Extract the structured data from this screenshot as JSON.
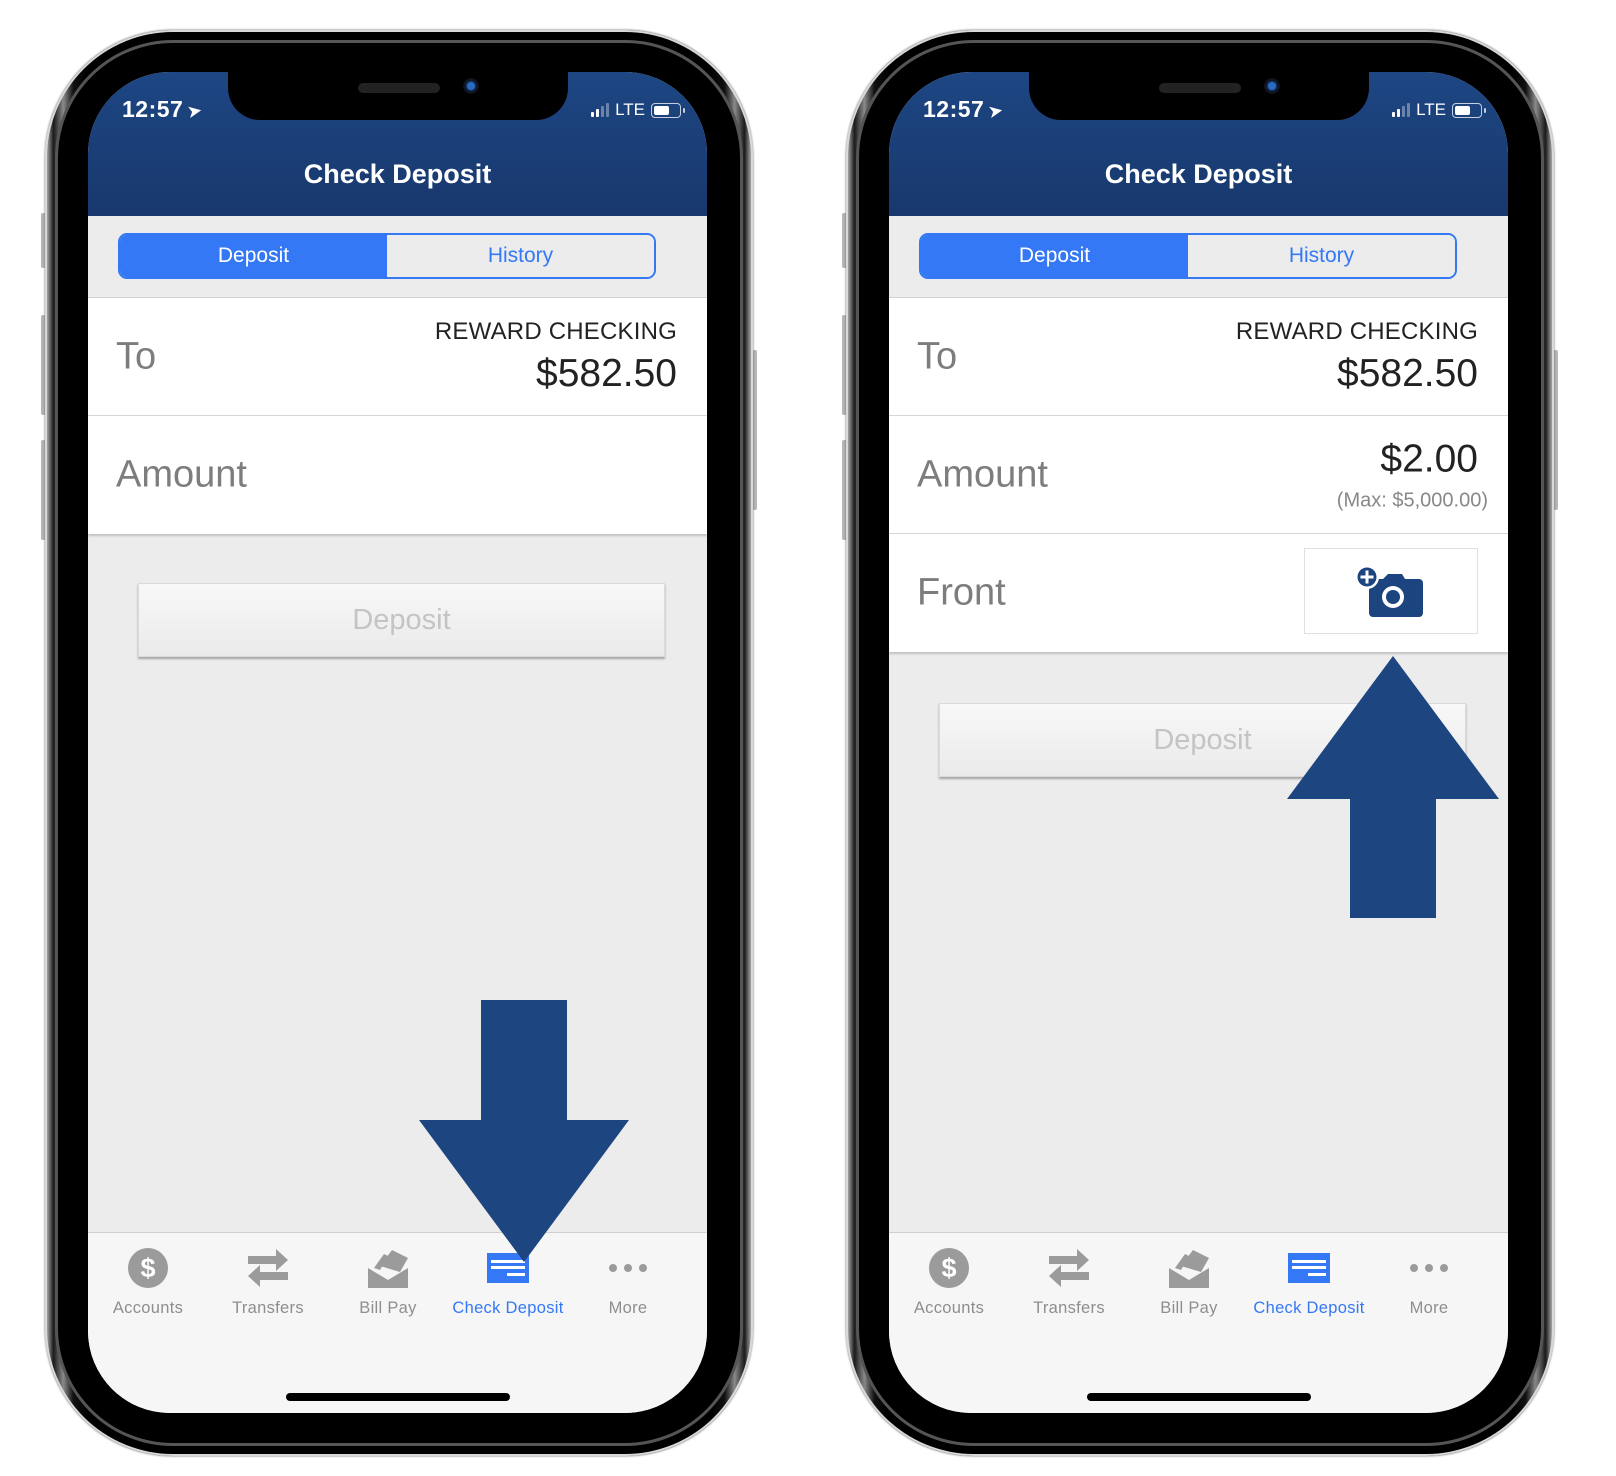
{
  "colors": {
    "header_blue": "#1d4683",
    "accent_blue": "#3478f6",
    "arrow_blue": "#1d4580",
    "camera_icon_blue": "#1c4580",
    "tab_inactive_gray": "#8e8e8e"
  },
  "phones": [
    {
      "status_bar": {
        "time": "12:57",
        "location_icon": "location-arrow-icon",
        "network": "LTE",
        "signal_bars_active": 2,
        "signal_bars_total": 4,
        "battery_level_percent": 60
      },
      "header": {
        "title": "Check Deposit"
      },
      "segmented_control": {
        "tabs": [
          {
            "label": "Deposit",
            "active": true
          },
          {
            "label": "History",
            "active": false
          }
        ]
      },
      "form": {
        "to": {
          "label": "To",
          "account_name": "REWARD CHECKING",
          "account_balance": "$582.50"
        },
        "amount": {
          "label": "Amount",
          "value": "",
          "max_note": ""
        }
      },
      "deposit_button": {
        "label": "Deposit",
        "enabled": false
      },
      "annotation_arrow": {
        "direction": "down",
        "points_to": "Check Deposit tab"
      },
      "tab_bar": {
        "items": [
          {
            "label": "Accounts",
            "icon": "dollar-circle-icon",
            "active": false
          },
          {
            "label": "Transfers",
            "icon": "transfer-arrows-icon",
            "active": false
          },
          {
            "label": "Bill Pay",
            "icon": "bill-envelope-icon",
            "active": false
          },
          {
            "label": "Check Deposit",
            "icon": "check-icon",
            "active": true
          },
          {
            "label": "More",
            "icon": "more-dots-icon",
            "active": false
          }
        ]
      }
    },
    {
      "status_bar": {
        "time": "12:57",
        "location_icon": "location-arrow-icon",
        "network": "LTE",
        "signal_bars_active": 2,
        "signal_bars_total": 4,
        "battery_level_percent": 60
      },
      "header": {
        "title": "Check Deposit"
      },
      "segmented_control": {
        "tabs": [
          {
            "label": "Deposit",
            "active": true
          },
          {
            "label": "History",
            "active": false
          }
        ]
      },
      "form": {
        "to": {
          "label": "To",
          "account_name": "REWARD CHECKING",
          "account_balance": "$582.50"
        },
        "amount": {
          "label": "Amount",
          "value": "$2.00",
          "max_note": "(Max: $5,000.00)"
        },
        "front": {
          "label": "Front",
          "icon": "add-camera-icon"
        }
      },
      "deposit_button": {
        "label": "Deposit",
        "enabled": false
      },
      "annotation_arrow": {
        "direction": "up",
        "points_to": "Front camera button"
      },
      "tab_bar": {
        "items": [
          {
            "label": "Accounts",
            "icon": "dollar-circle-icon",
            "active": false
          },
          {
            "label": "Transfers",
            "icon": "transfer-arrows-icon",
            "active": false
          },
          {
            "label": "Bill Pay",
            "icon": "bill-envelope-icon",
            "active": false
          },
          {
            "label": "Check Deposit",
            "icon": "check-icon",
            "active": true
          },
          {
            "label": "More",
            "icon": "more-dots-icon",
            "active": false
          }
        ]
      }
    }
  ]
}
